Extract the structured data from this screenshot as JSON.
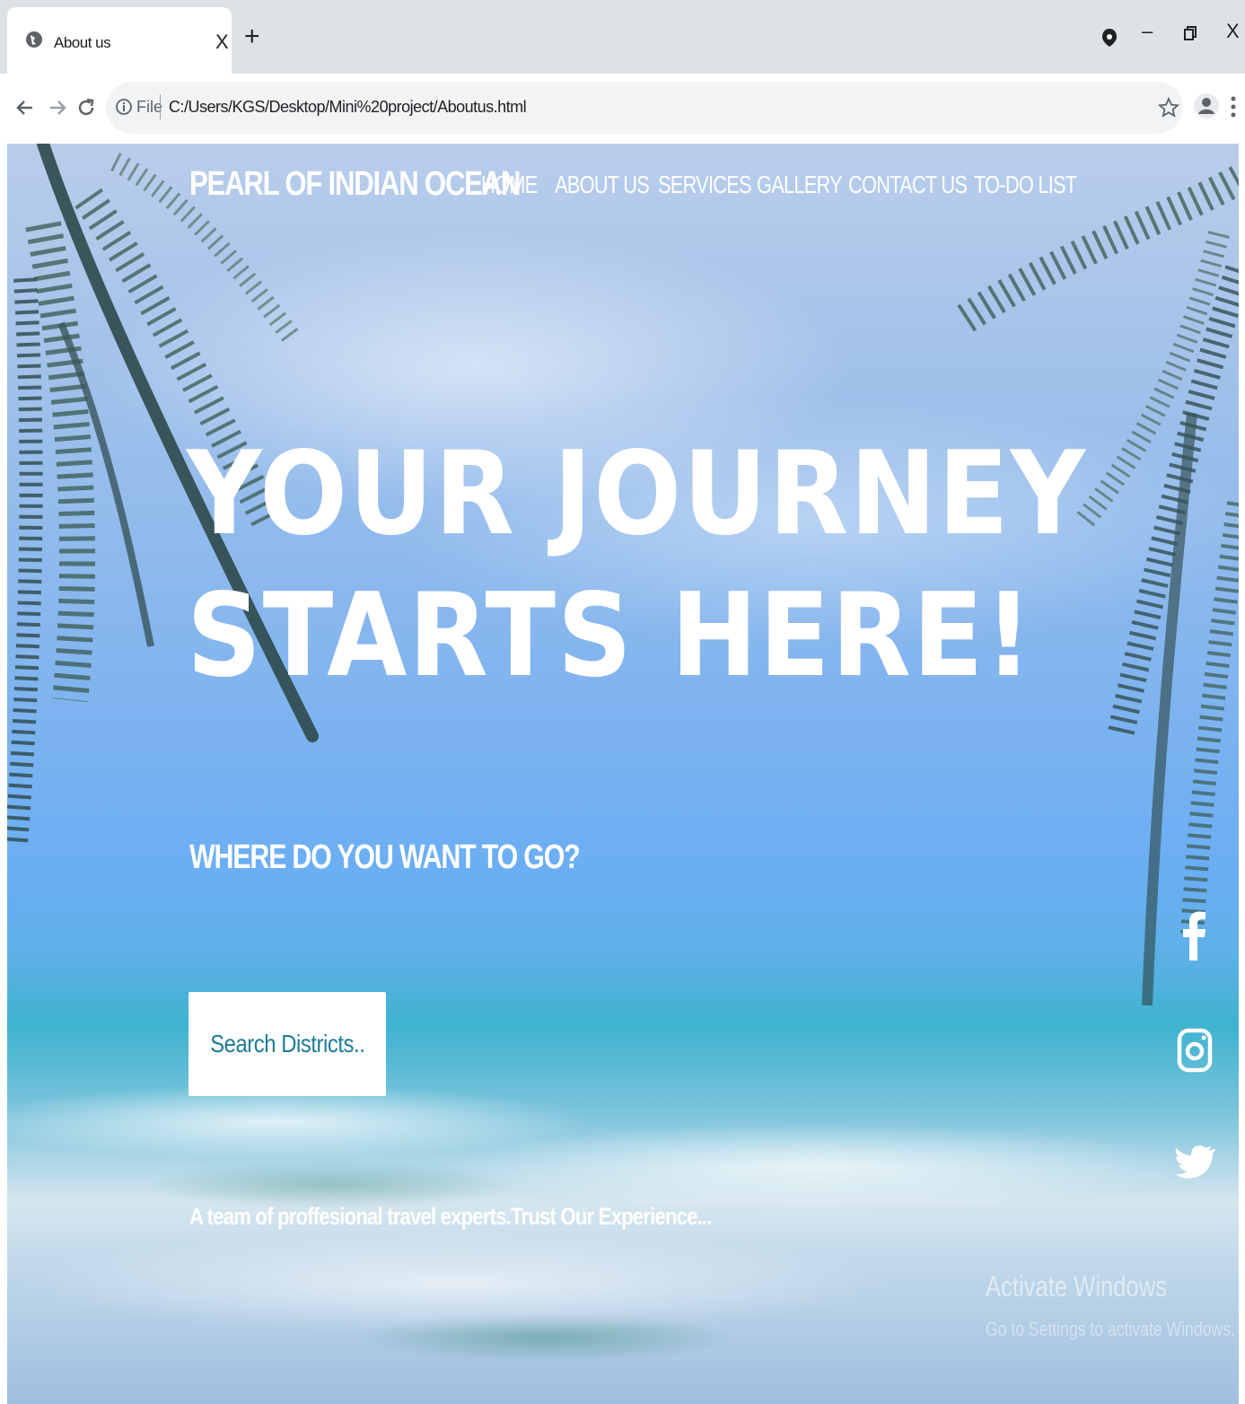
{
  "browser": {
    "tab_title": "About us",
    "tab_close": "X",
    "new_tab": "+",
    "file_label": "File",
    "url": "C:/Users/KGS/Desktop/Mini%20project/Aboutus.html",
    "icons": [
      "globe-icon",
      "close-icon",
      "plus-icon",
      "back-icon",
      "forward-icon",
      "reload-icon",
      "info-icon",
      "star-icon",
      "profile-icon",
      "menu-icon",
      "extension-icon",
      "minimize-icon",
      "restore-icon"
    ],
    "window_controls": {
      "minimize": "–",
      "close": "X"
    }
  },
  "site": {
    "brand": "PEARL OF INDIAN OCEAN",
    "nav": [
      {
        "label": "HOME"
      },
      {
        "label": "ABOUT US"
      },
      {
        "label": "SERVICES"
      },
      {
        "label": "GALLERY"
      },
      {
        "label": "CONTACT US"
      },
      {
        "label": "TO-DO LIST"
      }
    ],
    "hero": {
      "line1": "YOUR JOURNEY",
      "line2": "STARTS HERE!",
      "subtitle": "WHERE DO YOU WANT TO GO?",
      "search_button": "Search Districts..",
      "tagline": "A team of proffesional travel experts.Trust Our Experience..."
    },
    "social": [
      "facebook-icon",
      "instagram-icon",
      "twitter-icon"
    ],
    "colors": {
      "accent": "#1e7c96",
      "text": "#ffffff"
    }
  },
  "watermark": {
    "line1": "Activate Windows",
    "line2": "Go to Settings to activate Windows."
  }
}
